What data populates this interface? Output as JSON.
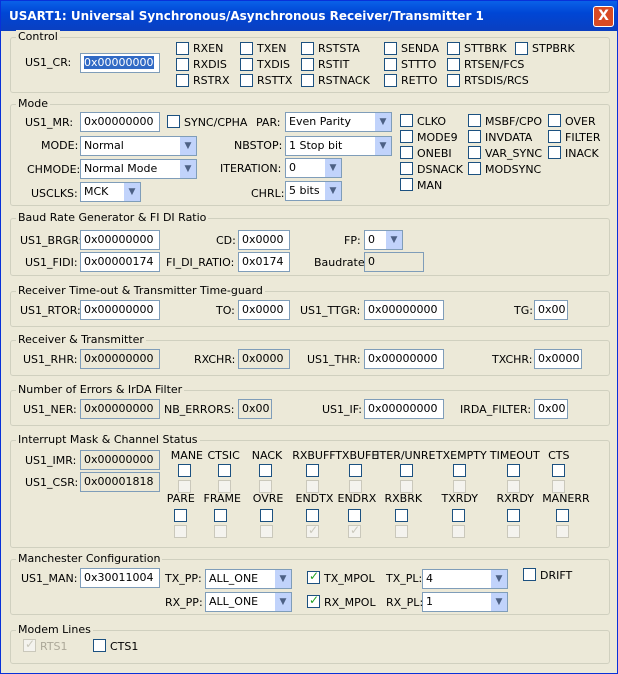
{
  "title": "USART1: Universal Synchronous/Asynchronous Receiver/Transmitter 1",
  "close_label": "X",
  "control": {
    "title": "Control",
    "reg_label": "US1_CR:",
    "reg_value": "0x00000000",
    "bits": [
      "RXEN",
      "TXEN",
      "RSTSTA",
      "SENDA",
      "STTBRK",
      "STPBRK",
      "RXDIS",
      "TXDIS",
      "RSTIT",
      "STTTO",
      "RTSEN/FCS",
      "RSTRX",
      "RSTTX",
      "RSTNACK",
      "RETTO",
      "RTSDIS/RCS"
    ]
  },
  "mode": {
    "title": "Mode",
    "mr_label": "US1_MR:",
    "mr_value": "0x00000000",
    "sync_label": "SYNC/CPHA",
    "par_label": "PAR:",
    "par_value": "Even Parity",
    "mode_label": "MODE:",
    "mode_value": "Normal",
    "nbstop_label": "NBSTOP:",
    "nbstop_value": "1 Stop bit",
    "chmode_label": "CHMODE:",
    "chmode_value": "Normal Mode",
    "iteration_label": "ITERATION:",
    "iteration_value": "0",
    "usclks_label": "USCLKS:",
    "usclks_value": "MCK",
    "chrl_label": "CHRL:",
    "chrl_value": "5 bits",
    "bits": [
      "CLKO",
      "MSBF/CPO",
      "OVER",
      "MODE9",
      "INVDATA",
      "FILTER",
      "ONEBI",
      "VAR_SYNC",
      "INACK",
      "DSNACK",
      "MODSYNC",
      "MAN"
    ]
  },
  "baud": {
    "title": "Baud Rate Generator & FI DI Ratio",
    "brgr_label": "US1_BRGR:",
    "brgr_value": "0x00000000",
    "cd_label": "CD:",
    "cd_value": "0x0000",
    "fp_label": "FP:",
    "fp_value": "0",
    "fidi_label": "US1_FIDI:",
    "fidi_value": "0x00000174",
    "fidiratio_label": "FI_DI_RATIO:",
    "fidiratio_value": "0x0174",
    "baudrate_label": "Baudrate:",
    "baudrate_value": "0"
  },
  "timeout": {
    "title": "Receiver Time-out & Transmitter Time-guard",
    "rtor_label": "US1_RTOR:",
    "rtor_value": "0x00000000",
    "to_label": "TO:",
    "to_value": "0x0000",
    "ttgr_label": "US1_TTGR:",
    "ttgr_value": "0x00000000",
    "tg_label": "TG:",
    "tg_value": "0x00"
  },
  "rxtx": {
    "title": "Receiver & Transmitter",
    "rhr_label": "US1_RHR:",
    "rhr_value": "0x00000000",
    "rxchr_label": "RXCHR:",
    "rxchr_value": "0x0000",
    "thr_label": "US1_THR:",
    "thr_value": "0x00000000",
    "txchr_label": "TXCHR:",
    "txchr_value": "0x0000"
  },
  "errors": {
    "title": "Number of Errors & IrDA Filter",
    "ner_label": "US1_NER:",
    "ner_value": "0x00000000",
    "nberr_label": "NB_ERRORS:",
    "nberr_value": "0x00",
    "if_label": "US1_IF:",
    "if_value": "0x00000000",
    "irda_label": "IRDA_FILTER:",
    "irda_value": "0x00"
  },
  "interrupt": {
    "title": "Interrupt Mask & Channel Status",
    "imr_label": "US1_IMR:",
    "imr_value": "0x00000000",
    "csr_label": "US1_CSR:",
    "csr_value": "0x00001818",
    "row1": [
      "MANE",
      "CTSIC",
      "NACK",
      "RXBUFF",
      "TXBUFE",
      "ITER/UNRE",
      "TXEMPTY",
      "TIMEOUT",
      "CTS"
    ],
    "row2": [
      "PARE",
      "FRAME",
      "OVRE",
      "ENDTX",
      "ENDRX",
      "RXBRK",
      "TXRDY",
      "RXRDY",
      "MANERR"
    ]
  },
  "manchester": {
    "title": "Manchester Configuration",
    "man_label": "US1_MAN:",
    "man_value": "0x30011004",
    "txpp_label": "TX_PP:",
    "txpp_value": "ALL_ONE",
    "txmpol_label": "TX_MPOL",
    "txpl_label": "TX_PL:",
    "txpl_value": "4",
    "drift_label": "DRIFT",
    "rxpp_label": "RX_PP:",
    "rxpp_value": "ALL_ONE",
    "rxmpol_label": "RX_MPOL",
    "rxpl_label": "RX_PL:",
    "rxpl_value": "1"
  },
  "modem": {
    "title": "Modem Lines",
    "rts_label": "RTS1",
    "cts_label": "CTS1"
  }
}
